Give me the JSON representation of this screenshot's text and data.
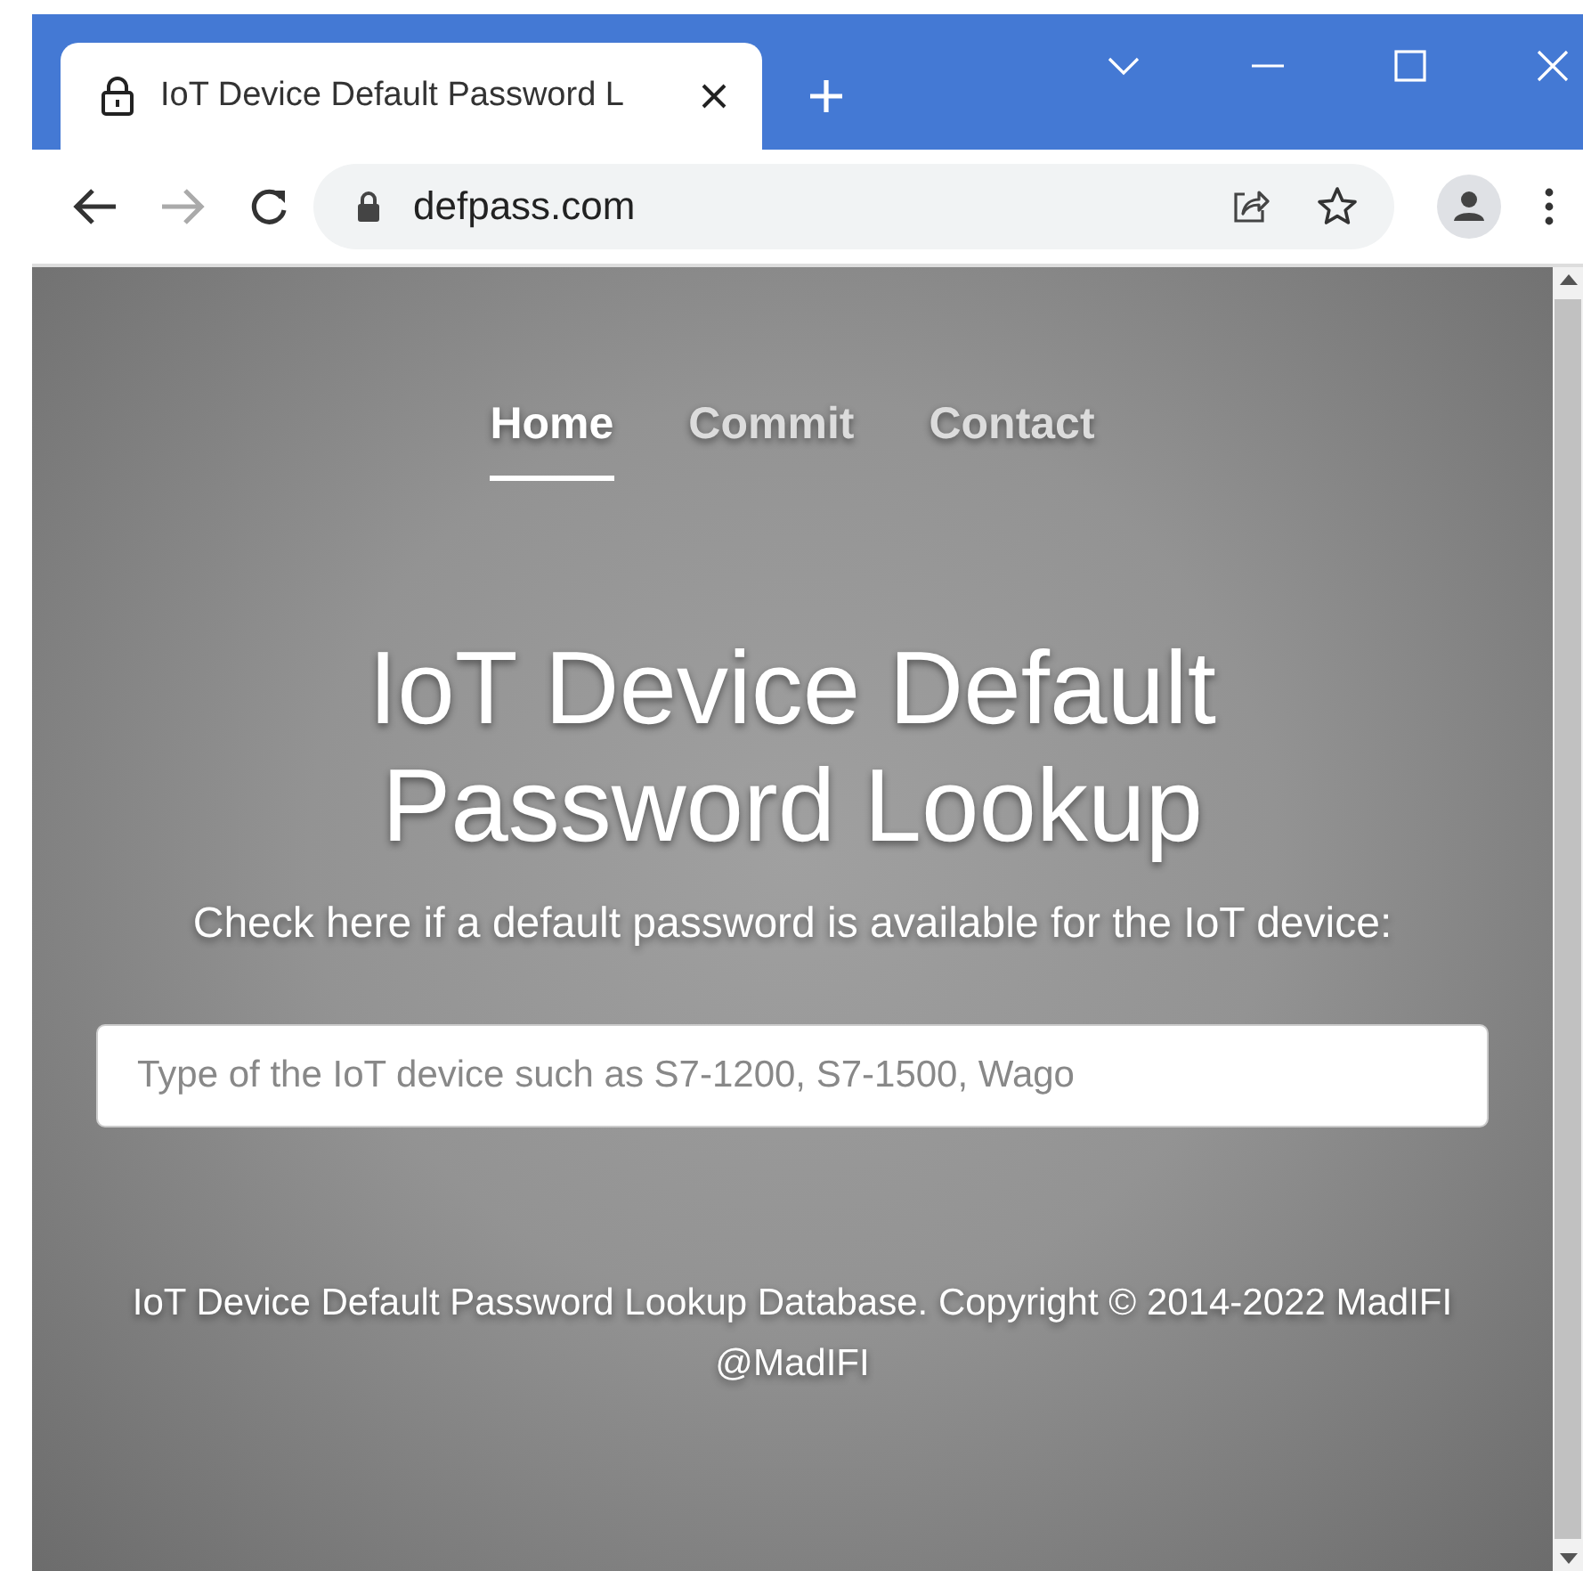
{
  "browser": {
    "tab_title": "IoT Device Default Password L",
    "address": "defpass.com"
  },
  "nav": [
    {
      "label": "Home",
      "selected": true
    },
    {
      "label": "Commit",
      "selected": false
    },
    {
      "label": "Contact",
      "selected": false
    }
  ],
  "hero": {
    "title": "IoT Device Default Password Lookup",
    "subtitle": "Check here if a default password is available for the IoT device:"
  },
  "search": {
    "placeholder": "Type of the IoT device such as S7-1200, S7-1500, Wago"
  },
  "footer": "IoT Device Default Password Lookup Database. Copyright © 2014-2022 MadIFI @MadIFI"
}
